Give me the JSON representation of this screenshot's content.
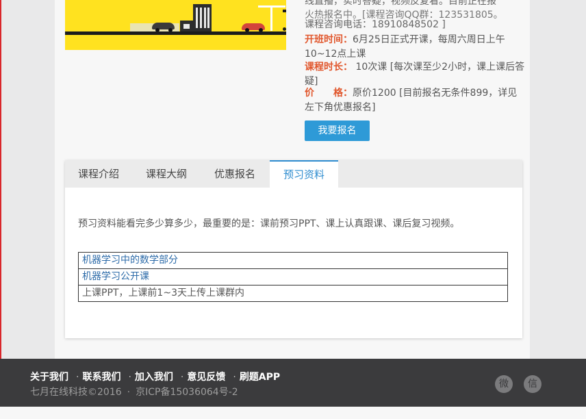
{
  "course": {
    "line_top": "线直播，实时答疑，视频反复看。目前正在报",
    "line_qq": "火热报名中。[课程咨询QQ群：123531805。",
    "line_phone": "课程咨询电话：18910848502 ]",
    "start_label": "开班时间：",
    "start_value": "6月25日正式开课，每周六周日上午10~12点上课",
    "duration_label": "课程时长：",
    "duration_value": " 10次课 [每次课至少2小时，课上课后答疑]",
    "price_label": "价　　格：",
    "price_value": "原价1200 [目前报名无条件899，详见左下角优惠报名]",
    "enroll_button": "我要报名"
  },
  "tabs": [
    {
      "label": "课程介绍",
      "active": false
    },
    {
      "label": "课程大纲",
      "active": false
    },
    {
      "label": "优惠报名",
      "active": false
    },
    {
      "label": "预习资料",
      "active": true
    }
  ],
  "preview": {
    "description": "预习资料能看完多少算多少，最重要的是：课前预习PPT、课上认真跟课、课后复习视频。",
    "resources": [
      {
        "text": "机器学习中的数学部分",
        "is_link": true
      },
      {
        "text": "机器学习公开课",
        "is_link": true
      },
      {
        "text": "上课PPT，上课前1~3天上传上课群内",
        "is_link": false
      }
    ]
  },
  "footer": {
    "links": [
      "关于我们",
      "联系我们",
      "加入我们",
      "意见反馈",
      "刷题APP"
    ],
    "copyright": "七月在线科技©2016",
    "icp": "京ICP备15036064号-2",
    "social": [
      {
        "icon": "weibo-icon",
        "glyph": "微"
      },
      {
        "icon": "wechat-icon",
        "glyph": "信"
      }
    ]
  },
  "colors": {
    "accent_blue": "#2e9ad7",
    "label_orange": "#e1572d",
    "footer_bg": "#3b3b3d",
    "banner_yellow": "#ffe21f"
  }
}
